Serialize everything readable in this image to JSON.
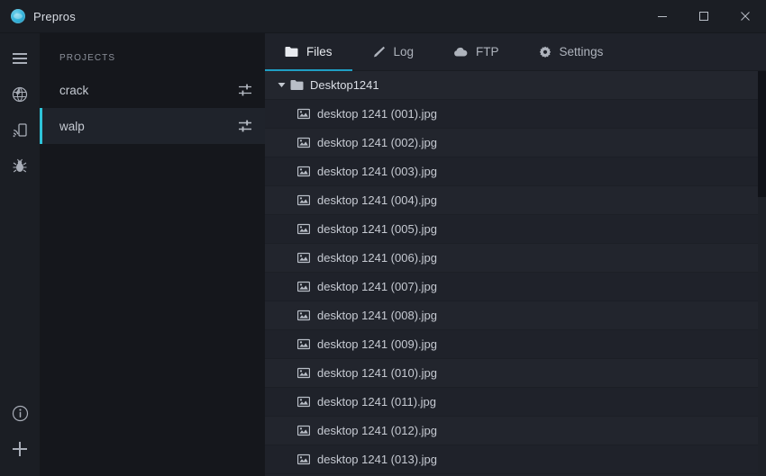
{
  "window": {
    "title": "Prepros",
    "logo_icon": "prepros-logo-icon",
    "controls": {
      "minimize": "minimize-icon",
      "maximize": "maximize-icon",
      "close": "close-icon"
    }
  },
  "rail": {
    "top_items": [
      {
        "icon": "hamburger-menu-icon",
        "name": "menu"
      },
      {
        "icon": "globe-icon",
        "name": "browser-preview"
      },
      {
        "icon": "device-preview-icon",
        "name": "device-preview"
      },
      {
        "icon": "bug-icon",
        "name": "debugger"
      }
    ],
    "bottom_items": [
      {
        "icon": "info-icon",
        "name": "info"
      },
      {
        "icon": "plus-icon",
        "name": "add-project"
      }
    ]
  },
  "sidebar": {
    "heading": "PROJECTS",
    "projects": [
      {
        "name": "crack",
        "selected": false,
        "config_icon": "sliders-icon"
      },
      {
        "name": "walp",
        "selected": true,
        "config_icon": "sliders-icon"
      }
    ]
  },
  "main": {
    "tabs": [
      {
        "label": "Files",
        "icon": "folder-icon",
        "active": true
      },
      {
        "label": "Log",
        "icon": "pencil-icon",
        "active": false
      },
      {
        "label": "FTP",
        "icon": "cloud-icon",
        "active": false
      },
      {
        "label": "Settings",
        "icon": "gear-icon",
        "active": false
      }
    ],
    "tree": {
      "folder": {
        "name": "Desktop1241",
        "expanded": true,
        "toggle_icon": "chevron-down-icon",
        "icon": "folder-icon"
      },
      "files": [
        {
          "name": "desktop 1241 (001).jpg",
          "icon": "image-file-icon"
        },
        {
          "name": "desktop 1241 (002).jpg",
          "icon": "image-file-icon"
        },
        {
          "name": "desktop 1241 (003).jpg",
          "icon": "image-file-icon"
        },
        {
          "name": "desktop 1241 (004).jpg",
          "icon": "image-file-icon"
        },
        {
          "name": "desktop 1241 (005).jpg",
          "icon": "image-file-icon"
        },
        {
          "name": "desktop 1241 (006).jpg",
          "icon": "image-file-icon"
        },
        {
          "name": "desktop 1241 (007).jpg",
          "icon": "image-file-icon"
        },
        {
          "name": "desktop 1241 (008).jpg",
          "icon": "image-file-icon"
        },
        {
          "name": "desktop 1241 (009).jpg",
          "icon": "image-file-icon"
        },
        {
          "name": "desktop 1241 (010).jpg",
          "icon": "image-file-icon"
        },
        {
          "name": "desktop 1241 (011).jpg",
          "icon": "image-file-icon"
        },
        {
          "name": "desktop 1241 (012).jpg",
          "icon": "image-file-icon"
        },
        {
          "name": "desktop 1241 (013).jpg",
          "icon": "image-file-icon"
        }
      ]
    }
  },
  "colors": {
    "accent": "#2ec3d8",
    "tab_underline": "#1f9fc4",
    "window_bg": "#1b1e24",
    "sidebar_bg": "#15171c",
    "main_bg": "#20232b"
  }
}
